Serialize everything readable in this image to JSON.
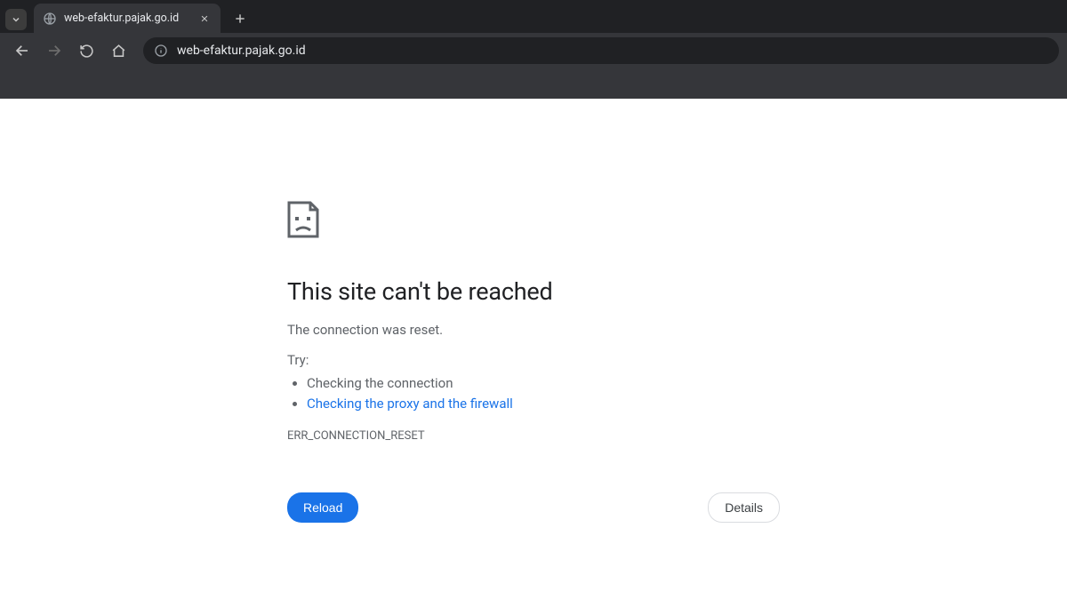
{
  "tab": {
    "title": "web-efaktur.pajak.go.id"
  },
  "omnibox": {
    "url": "web-efaktur.pajak.go.id"
  },
  "error": {
    "title": "This site can't be reached",
    "subtitle": "The connection was reset.",
    "try_label": "Try:",
    "suggestion1": "Checking the connection",
    "suggestion2": "Checking the proxy and the firewall",
    "code": "ERR_CONNECTION_RESET",
    "reload_label": "Reload",
    "details_label": "Details"
  }
}
